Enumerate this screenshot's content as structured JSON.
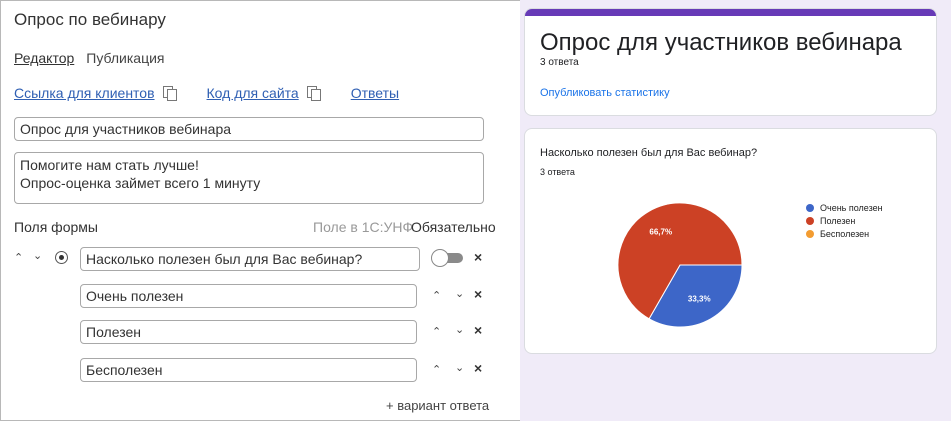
{
  "editor": {
    "title": "Опрос по вебинару",
    "tabs": [
      "Редактор",
      "Публикация"
    ],
    "links": [
      "Ссылка для клиентов",
      "Код для сайта",
      "Ответы"
    ],
    "survey_title": "Опрос для участников вебинара",
    "description": "Помогите нам стать лучше!\nОпрос-оценка займет всего 1 минуту",
    "fields_label": "Поля формы",
    "field_1c_label": "Поле в 1С:УНФ",
    "required_label": "Обязательно",
    "question": "Насколько полезен был для Вас вебинар?",
    "options": [
      "Очень полезен",
      "Полезен",
      "Бесполезен"
    ],
    "add_option": "+ вариант ответа",
    "required_toggle": false
  },
  "preview": {
    "title": "Опрос для участников вебинара",
    "responses": "3 ответа",
    "publish_link": "Опубликовать статистику",
    "question": "Насколько полезен был для Вас вебинар?",
    "question_responses": "3 ответа",
    "accent_color": "#673ab7"
  },
  "chart_data": {
    "type": "pie",
    "title": "Насколько полезен был для Вас вебинар?",
    "categories": [
      "Очень полезен",
      "Полезен",
      "Бесполезен"
    ],
    "values": [
      33.3,
      66.7,
      0
    ],
    "labels": [
      "33,3%",
      "66,7%",
      ""
    ],
    "colors": [
      "#3d66c8",
      "#cc4125",
      "#f39c31"
    ],
    "legend": "right"
  }
}
